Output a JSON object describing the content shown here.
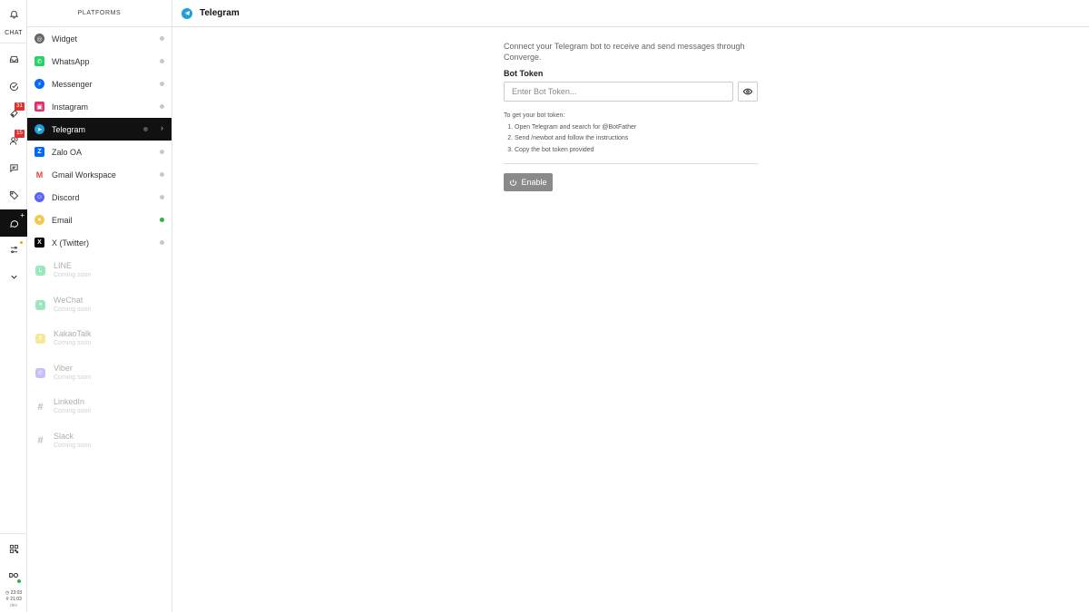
{
  "rail": {
    "section_label": "CHAT",
    "badges": {
      "tickets": "31",
      "contacts": "15"
    },
    "avatar_initials": "DO",
    "times": {
      "first": "23:03",
      "second": "21:03",
      "env": "dev"
    }
  },
  "panel": {
    "header": "PLATFORMS",
    "items": [
      {
        "label": "Widget",
        "icon": "widget-icon",
        "color": "#666666",
        "status": "gray"
      },
      {
        "label": "WhatsApp",
        "icon": "whatsapp-icon",
        "color": "#25D366",
        "status": "gray"
      },
      {
        "label": "Messenger",
        "icon": "messenger-icon",
        "color": "#0866FF",
        "status": "gray"
      },
      {
        "label": "Instagram",
        "icon": "instagram-icon",
        "color": "#E1306C",
        "status": "gray"
      },
      {
        "label": "Telegram",
        "icon": "telegram-icon",
        "color": "#229ED9",
        "status": "gray",
        "active": true
      },
      {
        "label": "Zalo OA",
        "icon": "zalo-icon",
        "color": "#0068FF",
        "status": "gray"
      },
      {
        "label": "Gmail Workspace",
        "icon": "gmail-icon",
        "color": "#EA4335",
        "status": "gray"
      },
      {
        "label": "Discord",
        "icon": "discord-icon",
        "color": "#5865F2",
        "status": "gray"
      },
      {
        "label": "Email",
        "icon": "email-icon",
        "color": "#F2C94C",
        "status": "green"
      },
      {
        "label": "X (Twitter)",
        "icon": "x-twitter-icon",
        "color": "#000000",
        "status": "gray"
      }
    ],
    "coming_soon_label": "Coming soon",
    "coming_soon": [
      {
        "label": "LINE",
        "icon": "line-icon",
        "color": "#06C755"
      },
      {
        "label": "WeChat",
        "icon": "wechat-icon",
        "color": "#07C160"
      },
      {
        "label": "KakaoTalk",
        "icon": "kakaotalk-icon",
        "color": "#E8C800"
      },
      {
        "label": "Viber",
        "icon": "viber-icon",
        "color": "#7360F2"
      },
      {
        "label": "LinkedIn",
        "icon": "linkedin-hash-icon",
        "color": "#555555"
      },
      {
        "label": "Slack",
        "icon": "slack-icon",
        "color": "#555555"
      }
    ]
  },
  "main": {
    "title": "Telegram",
    "intro": "Connect your Telegram bot to receive and send messages through Converge.",
    "token_label": "Bot Token",
    "token_placeholder": "Enter Bot Token...",
    "token_value": "",
    "help_title": "To get your bot token:",
    "steps": [
      "Open Telegram and search for @BotFather",
      "Send /newbot and follow the instructions",
      "Copy the bot token provided"
    ],
    "enable_label": "Enable"
  }
}
